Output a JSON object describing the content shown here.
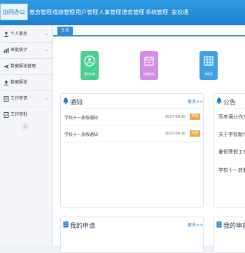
{
  "topnav": {
    "items": [
      "协同办公",
      "教务管理",
      "成绩管理",
      "用户管理",
      "人事管理",
      "德育管理",
      "系统管理",
      "家校通"
    ]
  },
  "sidebar": {
    "items": [
      {
        "label": "个人事务",
        "icon": "person-icon",
        "chevron": "⌄"
      },
      {
        "label": "审批统计",
        "icon": "chart-icon",
        "chevron": "⌄"
      },
      {
        "label": "数据报送管理",
        "icon": "plane-icon",
        "chevron": ""
      },
      {
        "label": "数据报送",
        "icon": "upload-icon",
        "chevron": ""
      },
      {
        "label": "工作审请",
        "icon": "doc-icon",
        "chevron": "⌄"
      },
      {
        "label": "工作审批",
        "icon": "doc-check-icon",
        "chevron": ""
      }
    ],
    "collapse": "‹"
  },
  "tabs": {
    "home": "主页"
  },
  "tiles": [
    {
      "label": "我的申请",
      "color": "#4ccf94",
      "icon": "person-doc-icon"
    },
    {
      "label": "待我审批",
      "color": "#d58ee8",
      "icon": "calendar-icon"
    },
    {
      "label": "课程表",
      "color": "#3fa0e8",
      "icon": "table-icon"
    }
  ],
  "notice": {
    "title": "通知",
    "more": "更多>>",
    "rows": [
      {
        "text": "学校十一放假通知",
        "date": "2017-06-10",
        "badge": "未读"
      },
      {
        "text": "学校十一放假通知",
        "date": "2017-06-10",
        "badge": "未读"
      }
    ]
  },
  "announcement": {
    "title": "公告",
    "rows": [
      "高考满分作文",
      "关于学校新行",
      "暑假寒假工作",
      "学校十一放假"
    ]
  },
  "my_applications": {
    "title": "我的申请",
    "more": "更多>>"
  },
  "my_approvals": {
    "title": "我的审批"
  },
  "colors": {
    "accent": "#1b7fd0",
    "badge": "#f0a445",
    "topbar": "#2f9be4"
  }
}
